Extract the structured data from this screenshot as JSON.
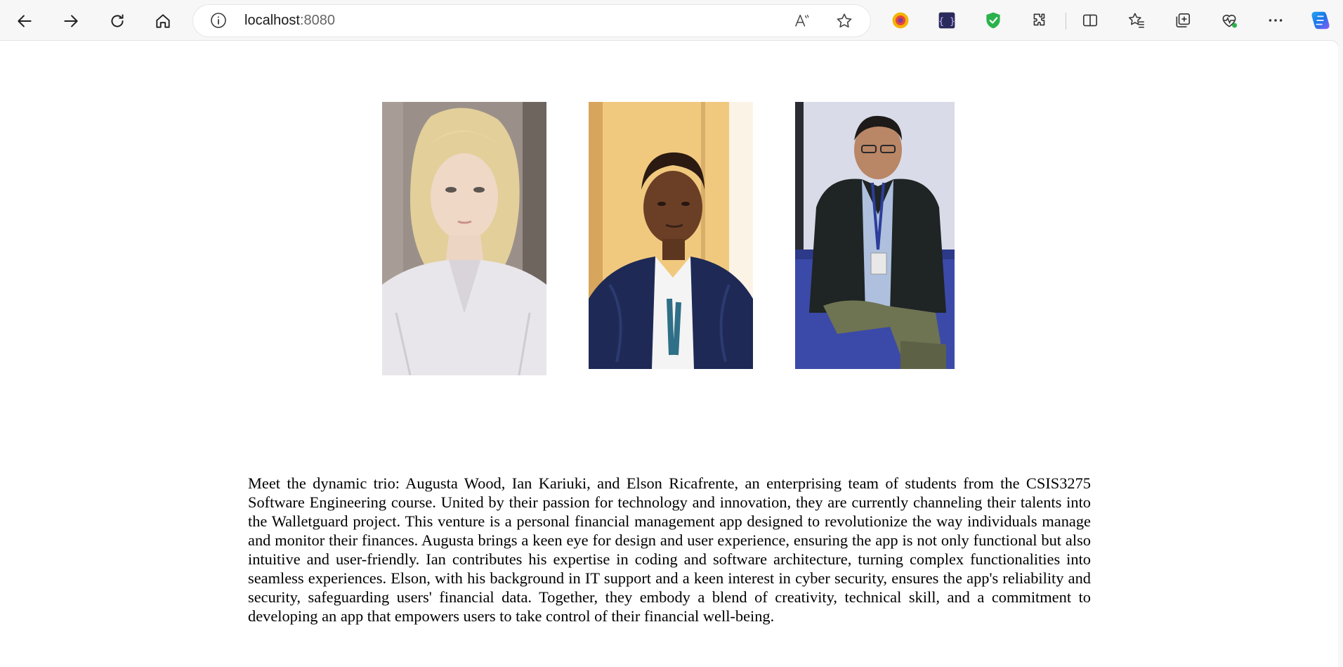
{
  "browser": {
    "address": {
      "host": "localhost",
      "port": ":8080"
    },
    "nav_icons": [
      "back-arrow-icon",
      "forward-arrow-icon",
      "reload-icon",
      "home-icon"
    ],
    "address_icons": [
      "site-info-icon",
      "read-aloud-icon",
      "favorite-star-icon"
    ],
    "extension_icons": [
      "colorful-extension-icon",
      "bracket-extension-icon",
      "shield-check-icon"
    ],
    "toolbar_icons": [
      "extensions-puzzle-icon",
      "split-screen-icon",
      "favorites-icon",
      "collections-icon",
      "browser-essentials-icon",
      "more-menu-icon",
      "copilot-icon"
    ]
  },
  "team": {
    "photos": [
      {
        "name": "Augusta Wood"
      },
      {
        "name": "Ian Kariuki"
      },
      {
        "name": "Elson Ricafrente"
      }
    ],
    "description": "Meet the dynamic trio: Augusta Wood, Ian Kariuki, and Elson Ricafrente, an enterprising team of students from the CSIS3275 Software Engineering course. United by their passion for technology and innovation, they are currently channeling their talents into the Walletguard project. This venture is a personal financial management app designed to revolutionize the way individuals manage and monitor their finances. Augusta brings a keen eye for design and user experience, ensuring the app is not only functional but also intuitive and user-friendly. Ian contributes his expertise in coding and software architecture, turning complex functionalities into seamless experiences. Elson, with his background in IT support and a keen interest in cyber security, ensures the app's reliability and security, safeguarding users' financial data. Together, they embody a blend of creativity, technical skill, and a commitment to developing an app that empowers users to take control of their financial well-being."
  },
  "colors": {
    "toolbar_bg": "#f7f7f7",
    "page_bg": "#ffffff",
    "shield_green": "#2bb24c",
    "copilot_blue": "#1a73e8"
  }
}
